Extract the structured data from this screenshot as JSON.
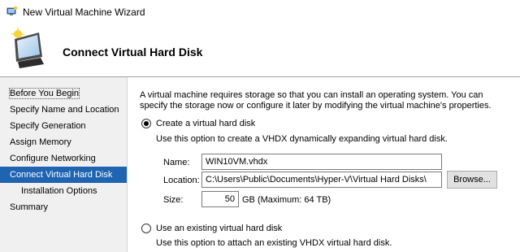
{
  "window": {
    "title": "New Virtual Machine Wizard"
  },
  "header": {
    "title": "Connect Virtual Hard Disk"
  },
  "nav": {
    "items": [
      {
        "label": "Before You Begin"
      },
      {
        "label": "Specify Name and Location"
      },
      {
        "label": "Specify Generation"
      },
      {
        "label": "Assign Memory"
      },
      {
        "label": "Configure Networking"
      },
      {
        "label": "Connect Virtual Hard Disk",
        "selected": true
      },
      {
        "label": "Installation Options"
      },
      {
        "label": "Summary"
      }
    ]
  },
  "main": {
    "intro": "A virtual machine requires storage so that you can install an operating system. You can specify the storage now or configure it later by modifying the virtual machine's properties.",
    "create_option": {
      "label": "Create a virtual hard disk",
      "checked": true,
      "description": "Use this option to create a VHDX dynamically expanding virtual hard disk."
    },
    "name_label": "Name:",
    "name_value": "WIN10VM.vhdx",
    "location_label": "Location:",
    "location_value": "C:\\Users\\Public\\Documents\\Hyper-V\\Virtual Hard Disks\\",
    "browse_label": "Browse...",
    "size_label": "Size:",
    "size_value": "50",
    "size_unit": "GB (Maximum: 64 TB)",
    "existing_option": {
      "label": "Use an existing virtual hard disk",
      "checked": false,
      "description": "Use this option to attach an existing VHDX virtual hard disk."
    }
  }
}
